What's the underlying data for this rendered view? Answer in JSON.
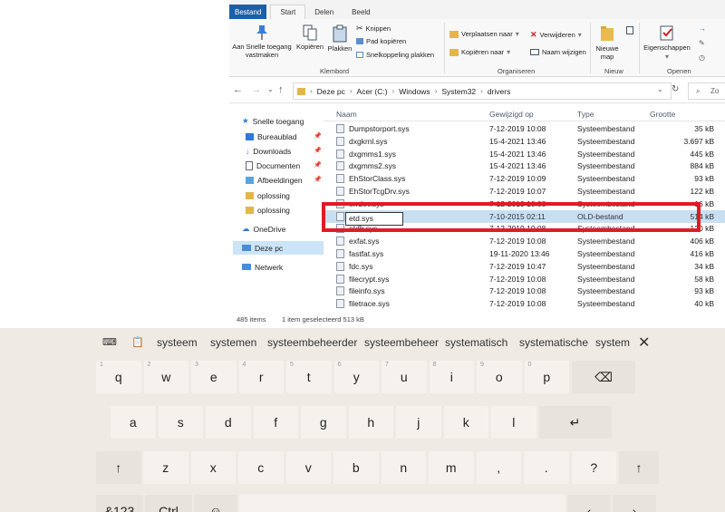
{
  "ribbon_tabs": [
    "Bestand",
    "Start",
    "Delen",
    "Beeld"
  ],
  "ribbon": {
    "pin_label": "Aan Snelle toegang vastmaken",
    "copy_label": "Kopiëren",
    "paste_label": "Plakken",
    "cut_label": "Knippen",
    "copy_path_label": "Pad kopiëren",
    "paste_shortcut_label": "Snelkoppeling plakken",
    "group_clipboard": "Klembord",
    "move_to_label": "Verplaatsen naar",
    "copy_to_label": "Kopiëren naar",
    "delete_label": "Verwijderen",
    "rename_label": "Naam wijzigen",
    "group_organize": "Organiseren",
    "new_folder_label": "Nieuwe map",
    "group_new": "Nieuw",
    "properties_label": "Eigenschappen",
    "group_open": "Openen"
  },
  "address": {
    "crumbs": [
      "Deze pc",
      "Acer (C:)",
      "Windows",
      "System32",
      "drivers"
    ],
    "search_placeholder": "Zo"
  },
  "nav": {
    "quick_access": "Snelle toegang",
    "items": [
      "Bureaublad",
      "Downloads",
      "Documenten",
      "Afbeeldingen",
      "oplossing",
      "oplossing"
    ],
    "onedrive": "OneDrive",
    "this_pc": "Deze pc",
    "network": "Netwerk"
  },
  "columns": {
    "name": "Naam",
    "date": "Gewijzigd op",
    "type": "Type",
    "size": "Grootte"
  },
  "files": [
    {
      "name": "Dumpstorport.sys",
      "date": "7-12-2019 10:08",
      "type": "Systeembestand",
      "size": "35 kB"
    },
    {
      "name": "dxgkrnl.sys",
      "date": "15-4-2021 13:46",
      "type": "Systeembestand",
      "size": "3.697 kB"
    },
    {
      "name": "dxgmms1.sys",
      "date": "15-4-2021 13:46",
      "type": "Systeembestand",
      "size": "445 kB"
    },
    {
      "name": "dxgmms2.sys",
      "date": "15-4-2021 13:46",
      "type": "Systeembestand",
      "size": "884 kB"
    },
    {
      "name": "EhStorClass.sys",
      "date": "7-12-2019 10:09",
      "type": "Systeembestand",
      "size": "93 kB"
    },
    {
      "name": "EhStorTcgDrv.sys",
      "date": "7-12-2019 10:07",
      "type": "Systeembestand",
      "size": "122 kB"
    },
    {
      "name": "errdev.sys",
      "date": "7-12-2019 10:08",
      "type": "Systeembestand",
      "size": "16 kB"
    },
    {
      "name": "etd.sys",
      "date": "7-10-2015 02:11",
      "type": "OLD-bestand",
      "size": "514 kB"
    },
    {
      "name": "etdb.sys",
      "date": "7-12-2019 10:08",
      "type": "Systeembestand",
      "size": "120 kB"
    },
    {
      "name": "exfat.sys",
      "date": "7-12-2019 10:08",
      "type": "Systeembestand",
      "size": "406 kB"
    },
    {
      "name": "fastfat.sys",
      "date": "19-11-2020 13:46",
      "type": "Systeembestand",
      "size": "416 kB"
    },
    {
      "name": "fdc.sys",
      "date": "7-12-2019 10:47",
      "type": "Systeembestand",
      "size": "34 kB"
    },
    {
      "name": "filecrypt.sys",
      "date": "7-12-2019 10:08",
      "type": "Systeembestand",
      "size": "58 kB"
    },
    {
      "name": "fileinfo.sys",
      "date": "7-12-2019 10:08",
      "type": "Systeembestand",
      "size": "93 kB"
    },
    {
      "name": "filetrace.sys",
      "date": "7-12-2019 10:08",
      "type": "Systeembestand",
      "size": "40 kB"
    }
  ],
  "status": {
    "count": "485 items",
    "selected": "1 item geselecteerd 513 kB"
  },
  "keyboard": {
    "suggestions": [
      "systeem",
      "systemen",
      "systeembeheerder",
      "systeembeheer",
      "systematisch",
      "systematische",
      "systema"
    ],
    "row1": [
      [
        "q",
        "1"
      ],
      [
        "w",
        "2"
      ],
      [
        "e",
        "3"
      ],
      [
        "r",
        "4"
      ],
      [
        "t",
        "5"
      ],
      [
        "y",
        "6"
      ],
      [
        "u",
        "7"
      ],
      [
        "i",
        "8"
      ],
      [
        "o",
        "9"
      ],
      [
        "p",
        "0"
      ]
    ],
    "row2": [
      "a",
      "s",
      "d",
      "f",
      "g",
      "h",
      "j",
      "k",
      "l"
    ],
    "row3": [
      "z",
      "x",
      "c",
      "v",
      "b",
      "n",
      "m",
      ",",
      ".",
      "?"
    ],
    "mode_label": "&123",
    "ctrl_label": "Ctrl"
  }
}
